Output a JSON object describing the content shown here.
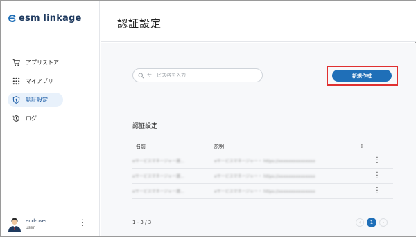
{
  "app": {
    "logo_text": "esm linkage"
  },
  "sidebar": {
    "items": [
      {
        "label": "アプリストア",
        "icon": "cart-icon"
      },
      {
        "label": "マイアプリ",
        "icon": "grid-icon"
      },
      {
        "label": "認証設定",
        "icon": "shield-icon"
      },
      {
        "label": "ログ",
        "icon": "history-icon"
      }
    ],
    "active_index": 2
  },
  "user": {
    "name": "end-user",
    "role": "user"
  },
  "header": {
    "title": "認証設定"
  },
  "search": {
    "placeholder": "サービス名を入力"
  },
  "toolbar": {
    "new_label": "新規作成"
  },
  "section": {
    "title": "認証設定"
  },
  "table": {
    "columns": [
      "名前",
      "説明"
    ],
    "rows": [
      {
        "name": "eサービスマネージャー連...",
        "desc": "eサービスマネージャー・ https://xxxxxxxxxxxxxxx"
      },
      {
        "name": "eサービスマネージャー連...",
        "desc": "eサービスマネージャー・ https://xxxxxxxxxxxxxxx"
      },
      {
        "name": "eサービスマネージャー連...",
        "desc": "eサービスマネージャー・ https://xxxxxxxxxxxxxxx"
      }
    ]
  },
  "pagination": {
    "range": "1 - 3 / 3",
    "current_page": "1"
  },
  "colors": {
    "accent": "#1f6fb8",
    "highlight_border": "#e03030",
    "active_nav_bg": "#e8f1fb"
  }
}
